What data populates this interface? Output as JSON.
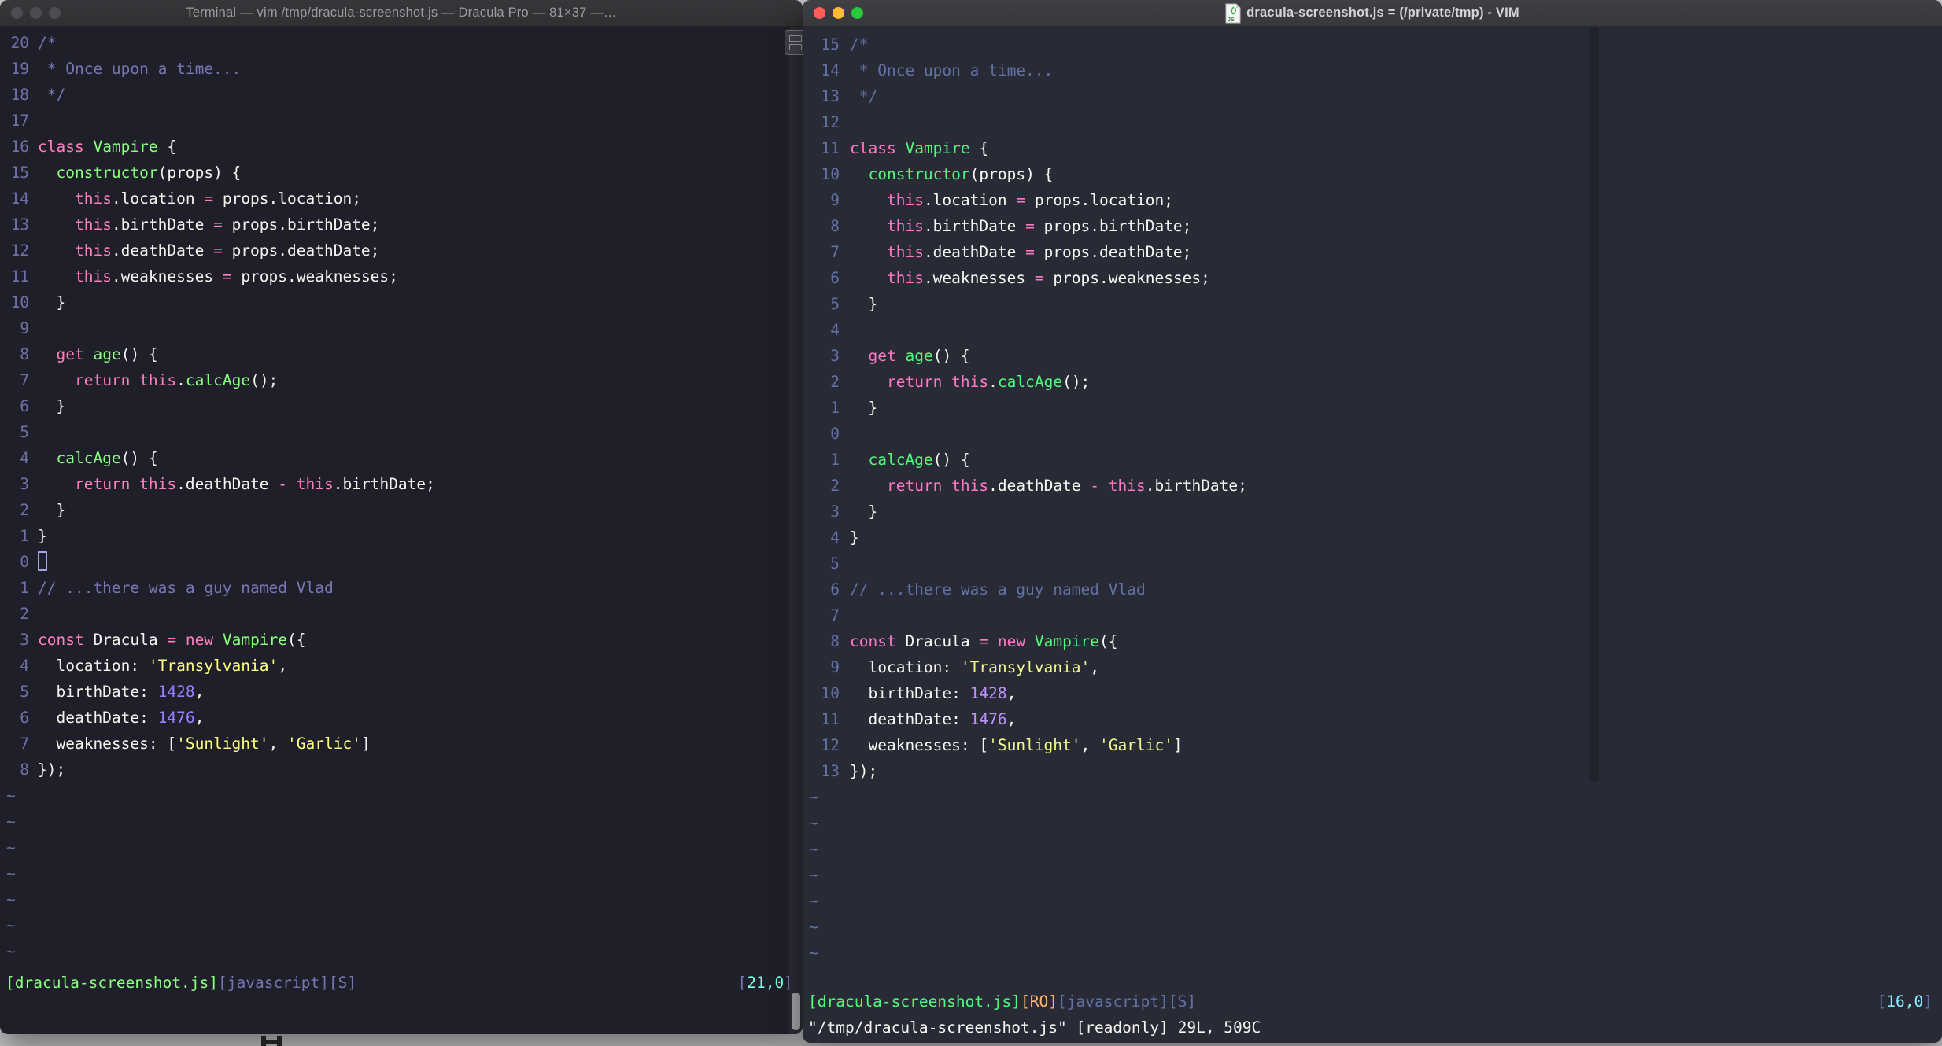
{
  "left_window": {
    "title": "Terminal — vim /tmp/dracula-screenshot.js — Dracula Pro — 81×37 —…",
    "numbers": [
      "20",
      "19",
      "18",
      "17",
      "16",
      "15",
      "14",
      "13",
      "12",
      "11",
      "10",
      "9",
      "8",
      "7",
      "6",
      "5",
      "4",
      "3",
      "2",
      "1",
      "0",
      "1",
      "2",
      "3",
      "4",
      "5",
      "6",
      "7",
      "8"
    ],
    "cursor_line": 20,
    "cursor_visible": true,
    "tilde_count": 7,
    "status_left": [
      [
        "[dracula-screenshot.js]",
        "green"
      ],
      [
        "[javascript][S]",
        "comment"
      ]
    ],
    "status_right": [
      [
        "[",
        "comment"
      ],
      [
        "21,0",
        "cyan"
      ],
      [
        "]",
        "comment"
      ]
    ]
  },
  "right_window": {
    "title": "dracula-screenshot.js = (/private/tmp) - VIM",
    "numbers": [
      "15",
      "14",
      "13",
      "12",
      "11",
      "10",
      "9",
      "8",
      "7",
      "6",
      "5",
      "4",
      "3",
      "2",
      "1",
      "0",
      "1",
      "2",
      "3",
      "4",
      "5",
      "6",
      "7",
      "8",
      "9",
      "10",
      "11",
      "12",
      "13"
    ],
    "cursor_line": 15,
    "cursor_visible": false,
    "tilde_count": 7,
    "status_left": [
      [
        "[dracula-screenshot.js]",
        "green"
      ],
      [
        "[RO]",
        "orange"
      ],
      [
        "[javascript][S]",
        "comment"
      ]
    ],
    "status_right": [
      [
        "[",
        "comment"
      ],
      [
        "16,0",
        "cyan"
      ],
      [
        "]",
        "comment"
      ]
    ],
    "message": "\"/tmp/dracula-screenshot.js\" [readonly] 29L, 509C"
  },
  "code_lines": [
    {
      "segs": [
        [
          "/*",
          "comment"
        ]
      ]
    },
    {
      "segs": [
        [
          " * Once upon a time...",
          "comment"
        ]
      ]
    },
    {
      "segs": [
        [
          " */",
          "comment"
        ]
      ]
    },
    {
      "segs": []
    },
    {
      "segs": [
        [
          "class",
          "pink"
        ],
        [
          " ",
          "fg"
        ],
        [
          "Vampire",
          "green"
        ],
        [
          " {",
          "fg"
        ]
      ]
    },
    {
      "segs": [
        [
          "  ",
          "fg"
        ],
        [
          "constructor",
          "green"
        ],
        [
          "(props) {",
          "fg"
        ]
      ]
    },
    {
      "segs": [
        [
          "    ",
          "fg"
        ],
        [
          "this",
          "pink"
        ],
        [
          ".location ",
          "fg"
        ],
        [
          "=",
          "pink"
        ],
        [
          " props.location;",
          "fg"
        ]
      ]
    },
    {
      "segs": [
        [
          "    ",
          "fg"
        ],
        [
          "this",
          "pink"
        ],
        [
          ".birthDate ",
          "fg"
        ],
        [
          "=",
          "pink"
        ],
        [
          " props.birthDate;",
          "fg"
        ]
      ]
    },
    {
      "segs": [
        [
          "    ",
          "fg"
        ],
        [
          "this",
          "pink"
        ],
        [
          ".deathDate ",
          "fg"
        ],
        [
          "=",
          "pink"
        ],
        [
          " props.deathDate;",
          "fg"
        ]
      ]
    },
    {
      "segs": [
        [
          "    ",
          "fg"
        ],
        [
          "this",
          "pink"
        ],
        [
          ".weaknesses ",
          "fg"
        ],
        [
          "=",
          "pink"
        ],
        [
          " props.weaknesses;",
          "fg"
        ]
      ]
    },
    {
      "segs": [
        [
          "  }",
          "fg"
        ]
      ]
    },
    {
      "segs": []
    },
    {
      "segs": [
        [
          "  ",
          "fg"
        ],
        [
          "get",
          "pink"
        ],
        [
          " ",
          "fg"
        ],
        [
          "age",
          "green"
        ],
        [
          "() {",
          "fg"
        ]
      ]
    },
    {
      "segs": [
        [
          "    ",
          "fg"
        ],
        [
          "return",
          "pink"
        ],
        [
          " ",
          "fg"
        ],
        [
          "this",
          "pink"
        ],
        [
          ".",
          "fg"
        ],
        [
          "calcAge",
          "green"
        ],
        [
          "();",
          "fg"
        ]
      ]
    },
    {
      "segs": [
        [
          "  }",
          "fg"
        ]
      ]
    },
    {
      "segs": []
    },
    {
      "segs": [
        [
          "  ",
          "fg"
        ],
        [
          "calcAge",
          "green"
        ],
        [
          "() {",
          "fg"
        ]
      ]
    },
    {
      "segs": [
        [
          "    ",
          "fg"
        ],
        [
          "return",
          "pink"
        ],
        [
          " ",
          "fg"
        ],
        [
          "this",
          "pink"
        ],
        [
          ".deathDate ",
          "fg"
        ],
        [
          "-",
          "pink"
        ],
        [
          " ",
          "fg"
        ],
        [
          "this",
          "pink"
        ],
        [
          ".birthDate;",
          "fg"
        ]
      ]
    },
    {
      "segs": [
        [
          "  }",
          "fg"
        ]
      ]
    },
    {
      "segs": [
        [
          "}",
          "fg"
        ]
      ]
    },
    {
      "segs": []
    },
    {
      "segs": [
        [
          "// ...there was a guy named Vlad",
          "comment"
        ]
      ]
    },
    {
      "segs": []
    },
    {
      "segs": [
        [
          "const",
          "pink"
        ],
        [
          " Dracula ",
          "fg"
        ],
        [
          "=",
          "pink"
        ],
        [
          " ",
          "fg"
        ],
        [
          "new",
          "pink"
        ],
        [
          " ",
          "fg"
        ],
        [
          "Vampire",
          "green"
        ],
        [
          "({",
          "fg"
        ]
      ]
    },
    {
      "segs": [
        [
          "  location: ",
          "fg"
        ],
        [
          "'Transylvania'",
          "yellow"
        ],
        [
          ",",
          "fg"
        ]
      ]
    },
    {
      "segs": [
        [
          "  birthDate: ",
          "fg"
        ],
        [
          "1428",
          "purple"
        ],
        [
          ",",
          "fg"
        ]
      ]
    },
    {
      "segs": [
        [
          "  deathDate: ",
          "fg"
        ],
        [
          "1476",
          "purple"
        ],
        [
          ",",
          "fg"
        ]
      ]
    },
    {
      "segs": [
        [
          "  weaknesses: [",
          "fg"
        ],
        [
          "'Sunlight'",
          "yellow"
        ],
        [
          ", ",
          "fg"
        ],
        [
          "'Garlic'",
          "yellow"
        ],
        [
          "]",
          "fg"
        ]
      ]
    },
    {
      "segs": [
        [
          "});",
          "fg"
        ]
      ]
    }
  ],
  "colors": {
    "left": {
      "bg": "#1E1F29",
      "fg": "#F4F4EF",
      "comment": "#7B74B3",
      "line_number": "#746EA8",
      "pink": "#FF80BF",
      "green": "#8AFF80",
      "yellow": "#FFFF80",
      "purple": "#9580FF",
      "cyan": "#80FFEA",
      "orange": "#FFCA80",
      "tilde": "#6F6A9E",
      "cursor_outline": "#A9A1EC",
      "titlebar_bg": "#343437",
      "traffic_light_inactive": "#4D4D51"
    },
    "right": {
      "bg": "#282A36",
      "fg": "#F8F8F2",
      "comment": "#6272A4",
      "line_number": "#6272A4",
      "pink": "#FF79C6",
      "green": "#50FA7B",
      "yellow": "#F1FA8C",
      "purple": "#BD93F9",
      "cyan": "#8BE9FD",
      "orange": "#FFB86C",
      "tilde": "#6272A4",
      "cursor_outline": "#BD93F9",
      "titlebar_bg": "#3C3C40",
      "traffic_red": "#FF5F57",
      "traffic_yellow": "#FEBC2E",
      "traffic_green": "#29C83F",
      "colorcolumn": "#21222C"
    }
  },
  "icons": {
    "js_file_icon": "js-document",
    "split_pane_icon": "split-panes",
    "traffic_lights": [
      "close",
      "minimize",
      "zoom"
    ]
  }
}
